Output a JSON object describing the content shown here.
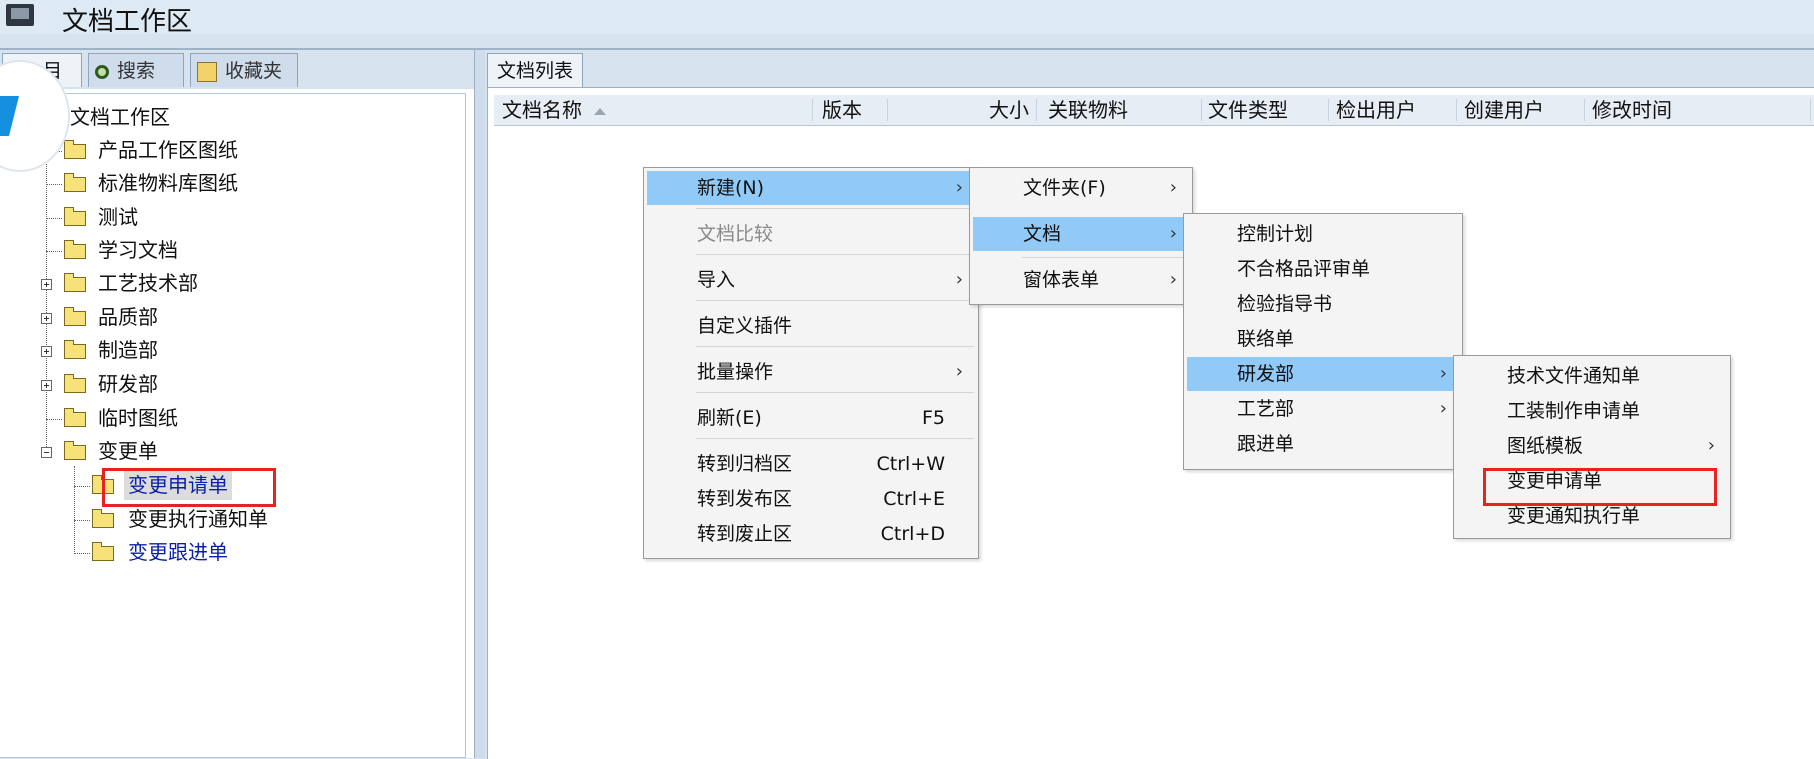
{
  "window": {
    "title": "文档工作区"
  },
  "left_tabs": [
    {
      "label": "目录"
    },
    {
      "label": "搜索",
      "icon": "search-icon"
    },
    {
      "label": "收藏夹",
      "icon": "favorites-icon"
    }
  ],
  "tree": {
    "root": "文档工作区",
    "items": [
      "产品工作区图纸",
      "标准物料库图纸",
      "测试",
      "学习文档",
      "工艺技术部",
      "品质部",
      "制造部",
      "研发部",
      "临时图纸",
      "变更单"
    ],
    "children_of_change": [
      "变更申请单",
      "变更执行通知单",
      "变更跟进单"
    ]
  },
  "right_tabs": [
    {
      "label": "文档列表"
    }
  ],
  "columns": [
    "文档名称",
    "版本",
    "大小",
    "关联物料",
    "文件类型",
    "检出用户",
    "创建用户",
    "修改时间"
  ],
  "context_menu": {
    "items": [
      {
        "label": "新建(N)"
      },
      {
        "label": "文档比较"
      },
      {
        "label": "导入"
      },
      {
        "label": "自定义插件"
      },
      {
        "label": "批量操作"
      },
      {
        "label": "刷新(E)",
        "shortcut": "F5"
      },
      {
        "label": "转到归档区",
        "shortcut": "Ctrl+W"
      },
      {
        "label": "转到发布区",
        "shortcut": "Ctrl+E"
      },
      {
        "label": "转到废止区",
        "shortcut": "Ctrl+D"
      }
    ]
  },
  "new_submenu": {
    "items": [
      "文件夹(F)",
      "文档",
      "窗体表单"
    ]
  },
  "doc_submenu": {
    "items": [
      "控制计划",
      "不合格品评审单",
      "检验指导书",
      "联络单",
      "研发部",
      "工艺部",
      "跟进单"
    ]
  },
  "rd_submenu": {
    "items": [
      "技术文件通知单",
      "工装制作申请单",
      "图纸模板",
      "变更申请单",
      "变更通知执行单"
    ]
  },
  "colors": {
    "highlight": "#91c9f7",
    "annotation": "#e8231f",
    "link_blue": "#0a1fa8"
  }
}
